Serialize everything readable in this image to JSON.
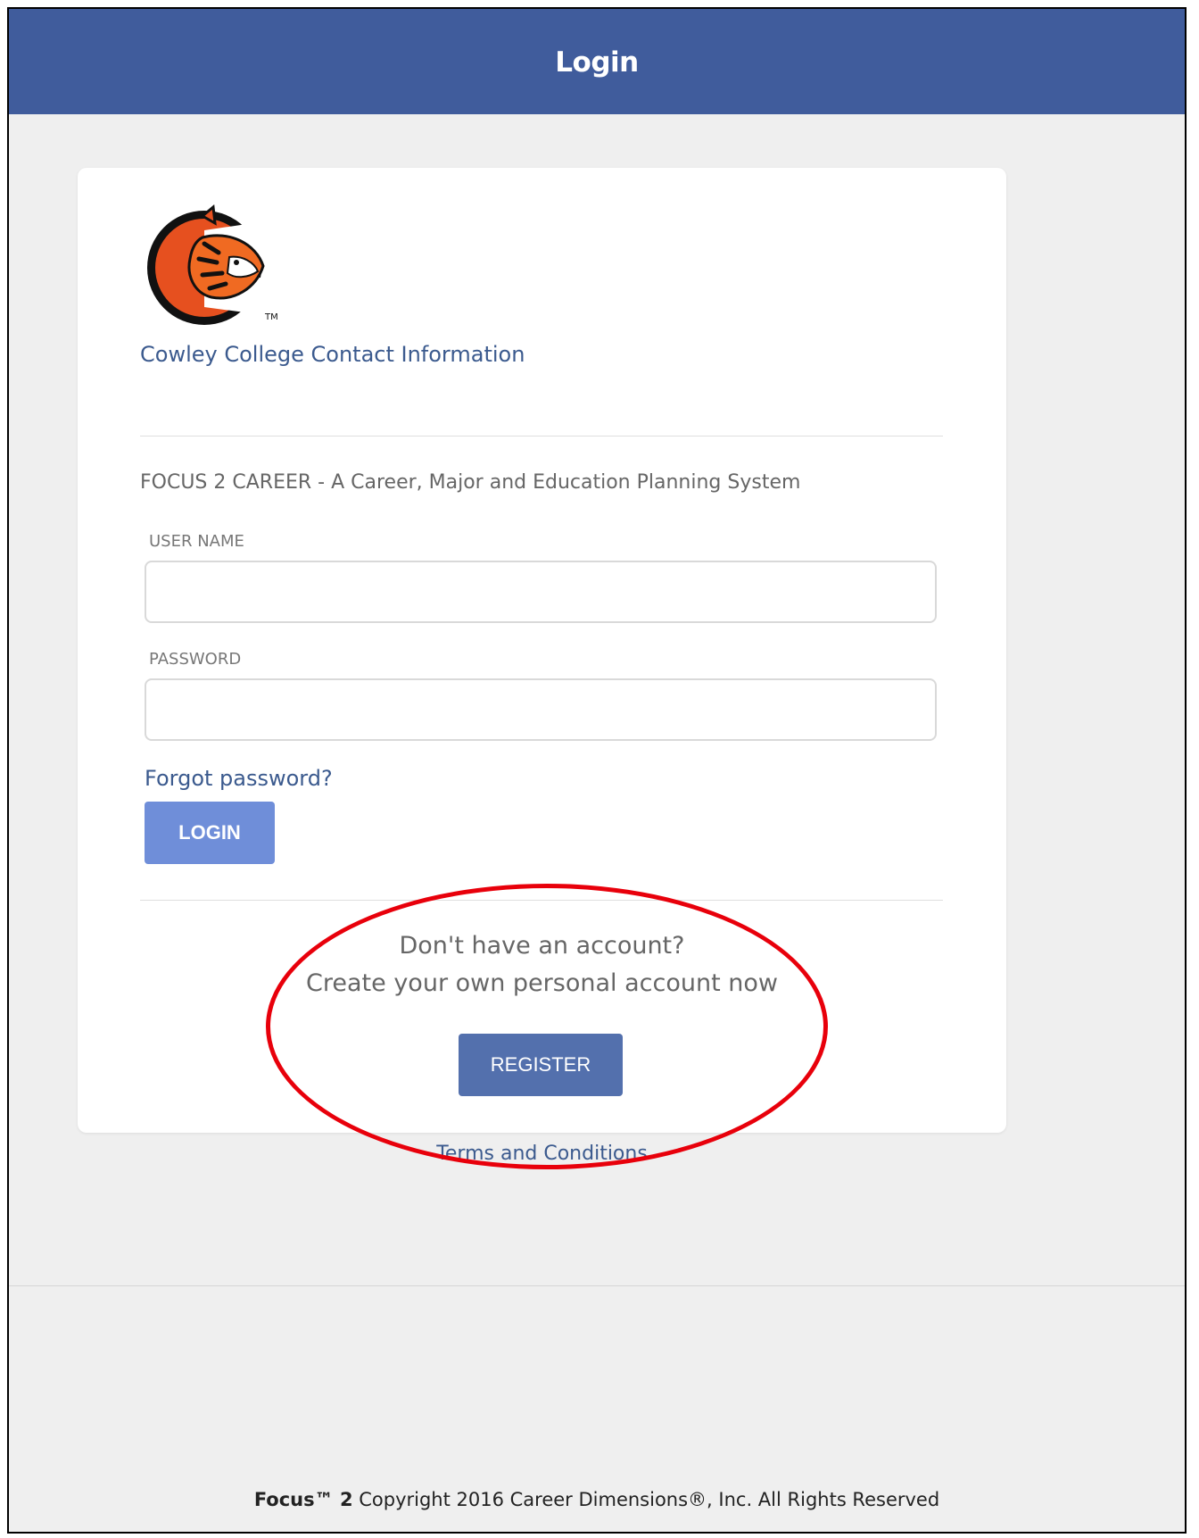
{
  "header": {
    "title": "Login"
  },
  "card": {
    "contact_link": "Cowley College Contact Information",
    "tagline": "FOCUS 2 CAREER - A Career, Major and Education Planning System",
    "username": {
      "label": "USER NAME",
      "value": ""
    },
    "password": {
      "label": "PASSWORD",
      "value": ""
    },
    "forgot_link": "Forgot password?",
    "login_button": "LOGIN",
    "register_prompt_line1": "Don't have an account?",
    "register_prompt_line2": "Create your own personal account now",
    "register_button": "REGISTER",
    "terms_link": "Terms and Conditions"
  },
  "footer": {
    "brand": "Focus™ 2",
    "text": " Copyright 2016 Career Dimensions®, Inc. All Rights Reserved"
  },
  "colors": {
    "header_bg": "#405c9c",
    "login_button_bg": "#6f8ed9",
    "register_button_bg": "#5370ad",
    "annotation": "#e8000b"
  },
  "icons": {
    "logo": "cowley-tiger-logo"
  }
}
